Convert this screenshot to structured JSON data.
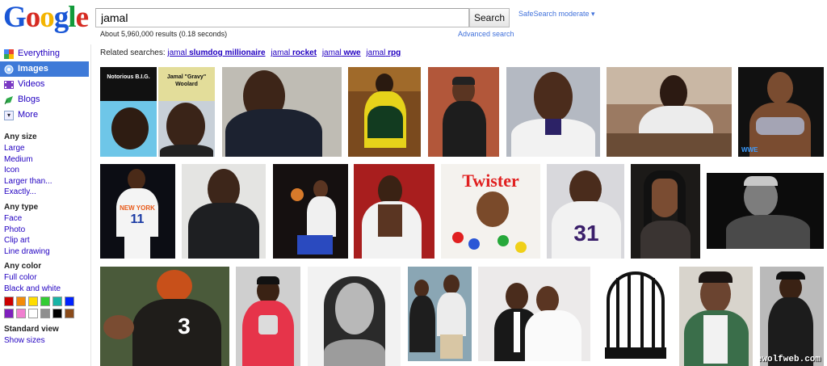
{
  "logo": "Google",
  "search": {
    "query": "jamal",
    "button_label": "Search"
  },
  "safesearch": "SafeSearch moderate ▾",
  "results_stats": "About 5,960,000 results (0.18 seconds)",
  "advanced_search": "Advanced search",
  "nav": {
    "items": [
      {
        "label": "Everything",
        "icon": "google-g-icon"
      },
      {
        "label": "Images",
        "icon": "images-icon"
      },
      {
        "label": "Videos",
        "icon": "videos-icon"
      },
      {
        "label": "Blogs",
        "icon": "blogs-icon"
      },
      {
        "label": "More",
        "icon": "more-icon"
      }
    ]
  },
  "filters": {
    "size": {
      "title": "Any size",
      "options": [
        "Large",
        "Medium",
        "Icon",
        "Larger than...",
        "Exactly..."
      ]
    },
    "type": {
      "title": "Any type",
      "options": [
        "Face",
        "Photo",
        "Clip art",
        "Line drawing"
      ]
    },
    "color": {
      "title": "Any color",
      "options": [
        "Full color",
        "Black and white"
      ],
      "swatches": [
        "#cc0000",
        "#f38b0a",
        "#ffdd00",
        "#33cc33",
        "#18b4a6",
        "#0022ff",
        "#7f1fbd",
        "#f07fd0",
        "#ffffff",
        "#8f8f8f",
        "#000000",
        "#8a4b1a"
      ]
    },
    "view": {
      "title": "Standard view",
      "options": [
        "Show sizes"
      ]
    }
  },
  "related": {
    "prefix": "Related searches:",
    "items": [
      {
        "q": "jamal",
        "b": "slumdog millionaire"
      },
      {
        "q": "jamal",
        "b": "rocket"
      },
      {
        "q": "jamal",
        "b": "wwe"
      },
      {
        "q": "jamal",
        "b": "rpg"
      }
    ]
  },
  "image_text": {
    "biggie_1": "Notorious B.I.G.",
    "biggie_2": "Jamal \"Gravy\" Woolard",
    "twister": "Twister",
    "jersey_11": "11",
    "jersey_31": "31",
    "jersey_3": "3",
    "newyork": "NEW YORK",
    "watermark": "thewolfweb.com"
  }
}
